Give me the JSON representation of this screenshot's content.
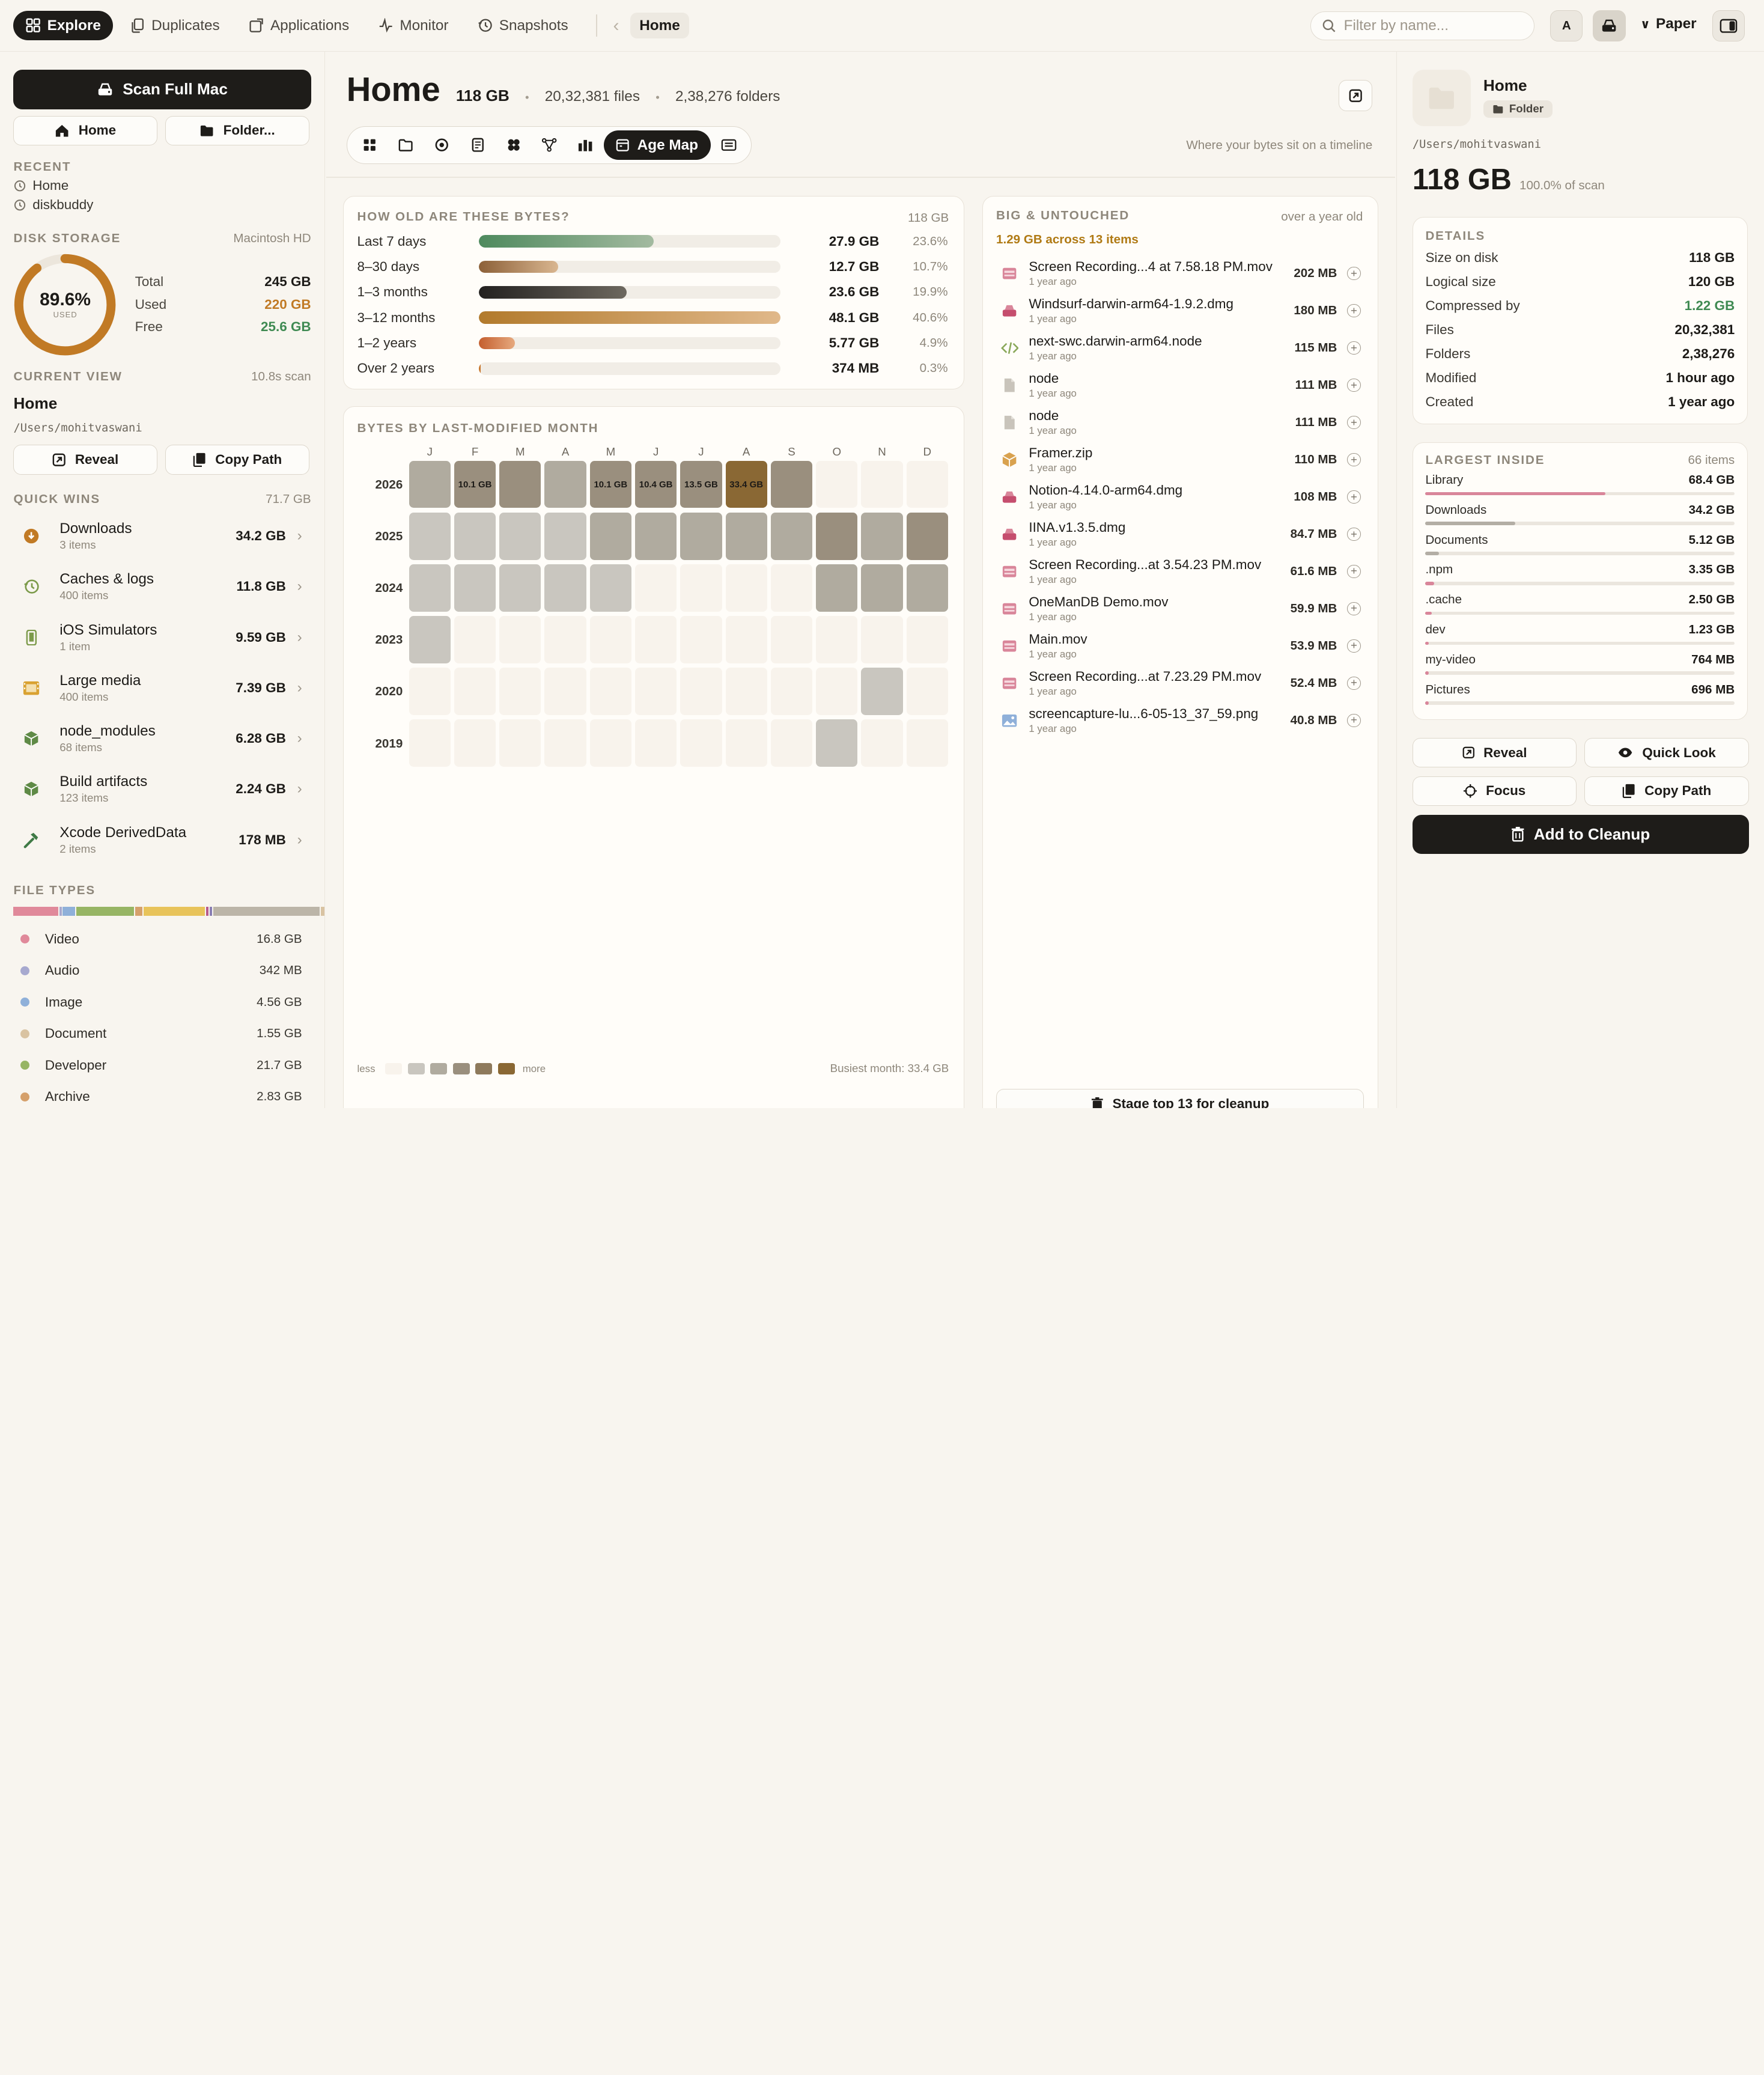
{
  "nav": {
    "tabs": [
      {
        "label": "Explore",
        "icon": "grid-icon"
      },
      {
        "label": "Duplicates",
        "icon": "duplicate-icon"
      },
      {
        "label": "Applications",
        "icon": "app-icon"
      },
      {
        "label": "Monitor",
        "icon": "pulse-icon"
      },
      {
        "label": "Snapshots",
        "icon": "history-icon"
      }
    ],
    "breadcrumb": "Home",
    "search_placeholder": "Filter by name...",
    "avatar_letter": "A",
    "theme": "Paper"
  },
  "sidebar": {
    "scan_label": "Scan Full Mac",
    "home_label": "Home",
    "folder_label": "Folder...",
    "recent_label": "RECENT",
    "recent": [
      "Home",
      "diskbuddy"
    ],
    "disk": {
      "label": "DISK STORAGE",
      "volume": "Macintosh HD",
      "used_pct_text": "89.6%",
      "used_pct": 89.6,
      "used_word": "USED",
      "total_label": "Total",
      "total": "245 GB",
      "used_label": "Used",
      "used": "220 GB",
      "free_label": "Free",
      "free": "25.6 GB"
    },
    "current_view": {
      "label": "CURRENT VIEW",
      "scan_time": "10.8s scan",
      "name": "Home",
      "path": "/Users/mohitvaswani",
      "reveal_label": "Reveal",
      "copy_label": "Copy Path"
    },
    "quick_wins": {
      "label": "QUICK WINS",
      "total": "71.7 GB",
      "items": [
        {
          "name": "Downloads",
          "sub": "3 items",
          "size": "34.2 GB",
          "icon": "download-icon"
        },
        {
          "name": "Caches & logs",
          "sub": "400 items",
          "size": "11.8 GB",
          "icon": "history-icon"
        },
        {
          "name": "iOS Simulators",
          "sub": "1 item",
          "size": "9.59 GB",
          "icon": "phone-icon"
        },
        {
          "name": "Large media",
          "sub": "400 items",
          "size": "7.39 GB",
          "icon": "film-icon"
        },
        {
          "name": "node_modules",
          "sub": "68 items",
          "size": "6.28 GB",
          "icon": "package-icon"
        },
        {
          "name": "Build artifacts",
          "sub": "123 items",
          "size": "2.24 GB",
          "icon": "package-icon"
        },
        {
          "name": "Xcode DerivedData",
          "sub": "2 items",
          "size": "178 MB",
          "icon": "hammer-icon"
        }
      ]
    },
    "file_types": {
      "label": "FILE TYPES",
      "items": [
        {
          "name": "Video",
          "size": "16.8 GB",
          "color": "#e0899a",
          "share": 16.8
        },
        {
          "name": "Audio",
          "size": "342 MB",
          "color": "#a7a9cf",
          "share": 0.34
        },
        {
          "name": "Image",
          "size": "4.56 GB",
          "color": "#8fb0d9",
          "share": 4.56
        },
        {
          "name": "Document",
          "size": "1.55 GB",
          "color": "#d9c3a2",
          "share": 1.55
        },
        {
          "name": "Developer",
          "size": "21.7 GB",
          "color": "#97b564",
          "share": 21.7
        },
        {
          "name": "Archive",
          "size": "2.83 GB",
          "color": "#d5a06b",
          "share": 2.83
        }
      ],
      "extra_segments": [
        {
          "color": "#e8c35a",
          "share": 23.0
        },
        {
          "color": "#b75a8c",
          "share": 0.9
        },
        {
          "color": "#8a7fb4",
          "share": 0.9
        },
        {
          "color": "#bcb5a8",
          "share": 40.0
        }
      ]
    }
  },
  "main": {
    "title": "Home",
    "size": "118 GB",
    "files": "20,32,381 files",
    "folders": "2,38,276 folders",
    "view_active": "Age Map",
    "view_note": "Where your bytes sit on a timeline",
    "age": {
      "label": "HOW OLD ARE THESE BYTES?",
      "total": "118 GB",
      "rows": [
        {
          "label": "Last 7 days",
          "size": "27.9 GB",
          "pct_text": "23.6%",
          "pct": 23.6,
          "fill": "linear-gradient(90deg,#4e8a5e,#a3baa0)"
        },
        {
          "label": "8–30 days",
          "size": "12.7 GB",
          "pct_text": "10.7%",
          "pct": 10.7,
          "fill": "linear-gradient(90deg,#8c6038,#d9b690)"
        },
        {
          "label": "1–3 months",
          "size": "23.6 GB",
          "pct_text": "19.9%",
          "pct": 19.9,
          "fill": "linear-gradient(90deg,#232120,#6d685f)"
        },
        {
          "label": "3–12 months",
          "size": "48.1 GB",
          "pct_text": "40.6%",
          "pct": 40.6,
          "fill": "linear-gradient(90deg,#b27a2c,#e0b88a)"
        },
        {
          "label": "1–2 years",
          "size": "5.77 GB",
          "pct_text": "4.9%",
          "pct": 4.9,
          "fill": "linear-gradient(90deg,#c45e2e,#e6a97e)"
        },
        {
          "label": "Over 2 years",
          "size": "374 MB",
          "pct_text": "0.3%",
          "pct": 0.3,
          "fill": "#c8782f"
        }
      ]
    },
    "month_map": {
      "label": "BYTES BY LAST-MODIFIED MONTH",
      "months": [
        "J",
        "F",
        "M",
        "A",
        "M",
        "J",
        "J",
        "A",
        "S",
        "O",
        "N",
        "D"
      ],
      "years": [
        "2026",
        "2025",
        "2024",
        "2023",
        "2020",
        "2019"
      ],
      "levels": [
        [
          2,
          3,
          3,
          2,
          3,
          3,
          3,
          5,
          3,
          0,
          0,
          0
        ],
        [
          1,
          1,
          1,
          1,
          2,
          2,
          2,
          2,
          2,
          3,
          2,
          3
        ],
        [
          1,
          1,
          1,
          1,
          1,
          0,
          0,
          0,
          0,
          2,
          2,
          2
        ],
        [
          1,
          0,
          0,
          0,
          0,
          0,
          0,
          0,
          0,
          0,
          0,
          0
        ],
        [
          0,
          0,
          0,
          0,
          0,
          0,
          0,
          0,
          0,
          0,
          1,
          0
        ],
        [
          0,
          0,
          0,
          0,
          0,
          0,
          0,
          0,
          0,
          1,
          0,
          0
        ]
      ],
      "labels": [
        [
          "",
          "10.1 GB",
          "",
          "",
          "10.1 GB",
          "10.4 GB",
          "13.5 GB",
          "33.4 GB",
          "",
          "",
          "",
          ""
        ],
        [
          "",
          "",
          "",
          "",
          "",
          "",
          "",
          "",
          "",
          "",
          "",
          ""
        ],
        [
          "",
          "",
          "",
          "",
          "",
          "",
          "",
          "",
          "",
          "",
          "",
          ""
        ],
        [
          "",
          "",
          "",
          "",
          "",
          "",
          "",
          "",
          "",
          "",
          "",
          ""
        ],
        [
          "",
          "",
          "",
          "",
          "",
          "",
          "",
          "",
          "",
          "",
          "",
          ""
        ],
        [
          "",
          "",
          "",
          "",
          "",
          "",
          "",
          "",
          "",
          "",
          "",
          ""
        ]
      ],
      "palette": [
        "#f8f3ec",
        "#c9c6bf",
        "#b0ab9f",
        "#9a8f7e",
        "#8e7a5c",
        "#8a6834"
      ],
      "legend_less": "less",
      "legend_more": "more",
      "busiest": "Busiest month: 33.4 GB"
    },
    "untouched": {
      "label": "BIG & UNTOUCHED",
      "meta": "over a year old",
      "summary": "1.29 GB across 13 items",
      "stage_label": "Stage top 13 for cleanup",
      "items": [
        {
          "name": "Screen Recording...4 at 7.58.18 PM.mov",
          "sub": "1 year ago",
          "size": "202 MB",
          "icon": "video-file-icon"
        },
        {
          "name": "Windsurf-darwin-arm64-1.9.2.dmg",
          "sub": "1 year ago",
          "size": "180 MB",
          "icon": "disk-image-icon"
        },
        {
          "name": "next-swc.darwin-arm64.node",
          "sub": "1 year ago",
          "size": "115 MB",
          "icon": "code-icon"
        },
        {
          "name": "node",
          "sub": "1 year ago",
          "size": "111 MB",
          "icon": "file-icon"
        },
        {
          "name": "node",
          "sub": "1 year ago",
          "size": "111 MB",
          "icon": "file-icon"
        },
        {
          "name": "Framer.zip",
          "sub": "1 year ago",
          "size": "110 MB",
          "icon": "archive-icon"
        },
        {
          "name": "Notion-4.14.0-arm64.dmg",
          "sub": "1 year ago",
          "size": "108 MB",
          "icon": "disk-image-icon"
        },
        {
          "name": "IINA.v1.3.5.dmg",
          "sub": "1 year ago",
          "size": "84.7 MB",
          "icon": "disk-image-icon"
        },
        {
          "name": "Screen Recording...at 3.54.23 PM.mov",
          "sub": "1 year ago",
          "size": "61.6 MB",
          "icon": "video-file-icon"
        },
        {
          "name": "OneManDB Demo.mov",
          "sub": "1 year ago",
          "size": "59.9 MB",
          "icon": "video-file-icon"
        },
        {
          "name": "Main.mov",
          "sub": "1 year ago",
          "size": "53.9 MB",
          "icon": "video-file-icon"
        },
        {
          "name": "Screen Recording...at 7.23.29 PM.mov",
          "sub": "1 year ago",
          "size": "52.4 MB",
          "icon": "video-file-icon"
        },
        {
          "name": "screencapture-lu...6-05-13_37_59.png",
          "sub": "1 year ago",
          "size": "40.8 MB",
          "icon": "image-file-icon"
        }
      ]
    }
  },
  "inspector": {
    "name": "Home",
    "kind": "Folder",
    "path": "/Users/mohitvaswani",
    "size": "118 GB",
    "scan_share": "100.0% of scan",
    "details_label": "DETAILS",
    "details": [
      {
        "label": "Size on disk",
        "value": "118 GB",
        "accent": false
      },
      {
        "label": "Logical size",
        "value": "120 GB",
        "accent": false
      },
      {
        "label": "Compressed by",
        "value": "1.22 GB",
        "accent": true
      },
      {
        "label": "Files",
        "value": "20,32,381",
        "accent": false
      },
      {
        "label": "Folders",
        "value": "2,38,276",
        "accent": false
      },
      {
        "label": "Modified",
        "value": "1 hour ago",
        "accent": false
      },
      {
        "label": "Created",
        "value": "1 year ago",
        "accent": false
      }
    ],
    "largest_label": "LARGEST INSIDE",
    "largest_count": "66 items",
    "largest": [
      {
        "name": "Library",
        "size": "68.4 GB",
        "share": 0.58,
        "color": "#d9869a"
      },
      {
        "name": "Downloads",
        "size": "34.2 GB",
        "share": 0.29,
        "color": "#b3aea5"
      },
      {
        "name": "Documents",
        "size": "5.12 GB",
        "share": 0.043,
        "color": "#b3aea5"
      },
      {
        "name": ".npm",
        "size": "3.35 GB",
        "share": 0.028,
        "color": "#d9869a"
      },
      {
        "name": ".cache",
        "size": "2.50 GB",
        "share": 0.021,
        "color": "#d9869a"
      },
      {
        "name": "dev",
        "size": "1.23 GB",
        "share": 0.01,
        "color": "#d9869a"
      },
      {
        "name": "my-video",
        "size": "764 MB",
        "share": 0.0065,
        "color": "#d9869a"
      },
      {
        "name": "Pictures",
        "size": "696 MB",
        "share": 0.006,
        "color": "#d9869a"
      }
    ],
    "reveal_label": "Reveal",
    "quicklook_label": "Quick Look",
    "focus_label": "Focus",
    "copy_label": "Copy Path",
    "cleanup_label": "Add to Cleanup"
  },
  "colors": {
    "accent_dark": "#1e1c19",
    "used_orange": "#c17a25",
    "free_green": "#3f8a52",
    "gold_text": "#b07a14"
  }
}
